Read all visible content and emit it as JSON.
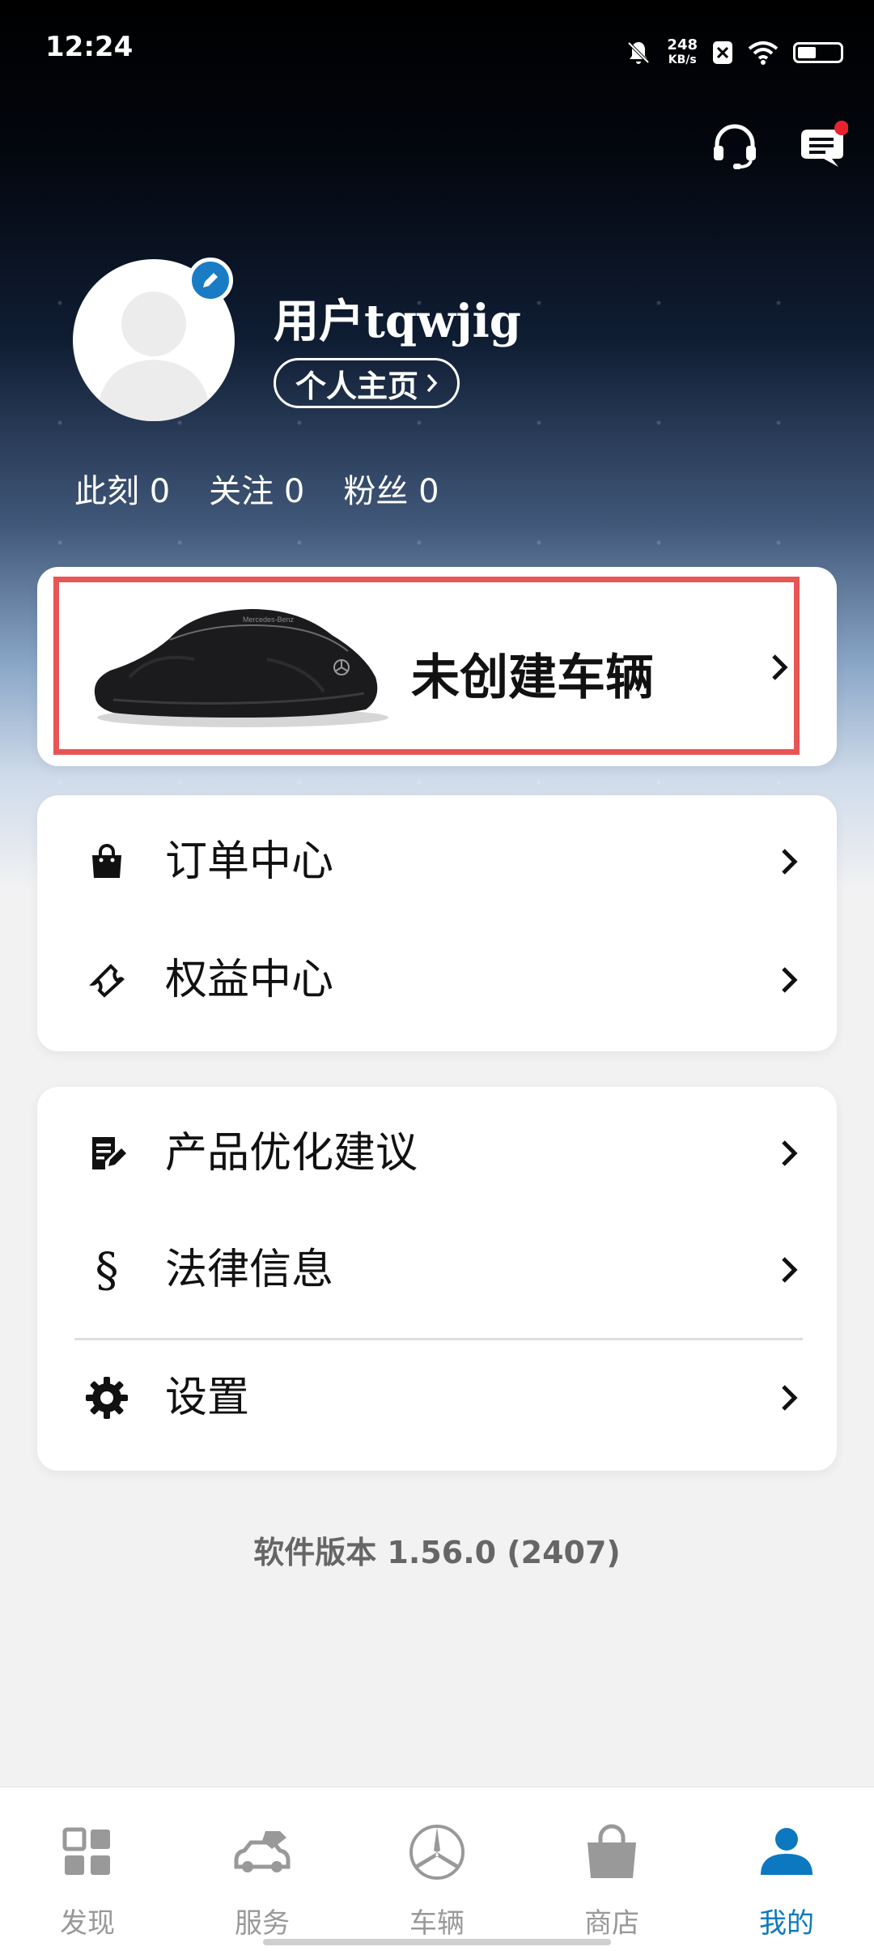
{
  "status_bar": {
    "time": "12:24",
    "net_speed_value": "248",
    "net_speed_unit": "KB/s"
  },
  "profile": {
    "username": "用户tqwjig",
    "homepage_label": "个人主页",
    "stats": [
      {
        "label": "此刻",
        "value": "0"
      },
      {
        "label": "关注",
        "value": "0"
      },
      {
        "label": "粉丝",
        "value": "0"
      }
    ]
  },
  "vehicle": {
    "label": "未创建车辆",
    "car_logo_text": "Mercedes-Benz"
  },
  "menu_group1": [
    {
      "label": "订单中心",
      "icon": "shopping-bag-icon"
    },
    {
      "label": "权益中心",
      "icon": "ticket-icon"
    }
  ],
  "menu_group2": [
    {
      "label": "产品优化建议",
      "icon": "feedback-icon"
    },
    {
      "label": "法律信息",
      "icon": "section-sign-icon"
    },
    {
      "label": "设置",
      "icon": "gear-icon"
    }
  ],
  "version_text": "软件版本 1.56.0 (2407)",
  "tabs": [
    {
      "label": "发现",
      "icon": "discover-grid-icon"
    },
    {
      "label": "服务",
      "icon": "service-car-icon"
    },
    {
      "label": "车辆",
      "icon": "mercedes-star-icon"
    },
    {
      "label": "商店",
      "icon": "shop-bag-icon"
    },
    {
      "label": "我的",
      "icon": "profile-icon",
      "active": true
    }
  ],
  "colors": {
    "accent": "#0c78bf",
    "highlight_border": "#e85555",
    "notification_dot": "#e8232f"
  }
}
